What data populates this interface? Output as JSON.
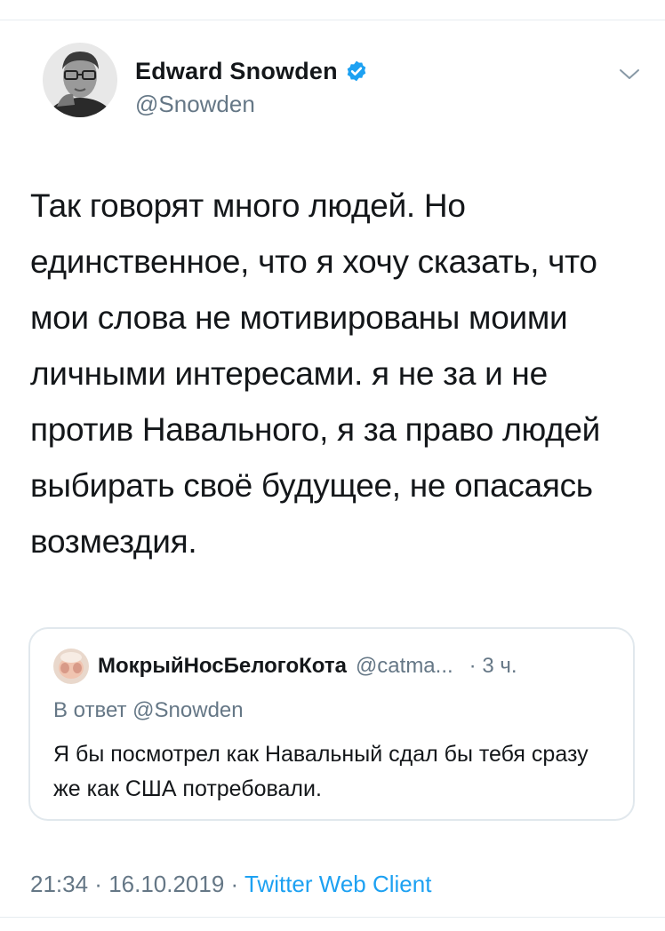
{
  "tweet": {
    "author": {
      "name": "Edward Snowden",
      "handle": "@Snowden",
      "verified": true
    },
    "text": "Так говорят много людей. Но единственное, что я хочу сказать, что мои слова не мотивированы моими личными интересами. я не за и не против Навального, я за право людей выбирать своё будущее, не опасаясь возмездия.",
    "time": "21:34",
    "separator": " · ",
    "date": "16.10.2019",
    "source": "Twitter Web Client"
  },
  "quote": {
    "author_name": "МокрыйНосБелогоКота",
    "author_handle": "@catma...",
    "time_ago": "· 3 ч.",
    "reply_to": "В ответ @Snowden",
    "text": "Я бы посмотрел как Навальный сдал бы тебя сразу же как США потребовали."
  },
  "colors": {
    "primary_text": "#14171a",
    "secondary_text": "#657786",
    "accent": "#1da1f2",
    "border": "#e1e8ed"
  },
  "icons": {
    "verified": "verified-badge-icon",
    "menu": "chevron-down-icon"
  }
}
